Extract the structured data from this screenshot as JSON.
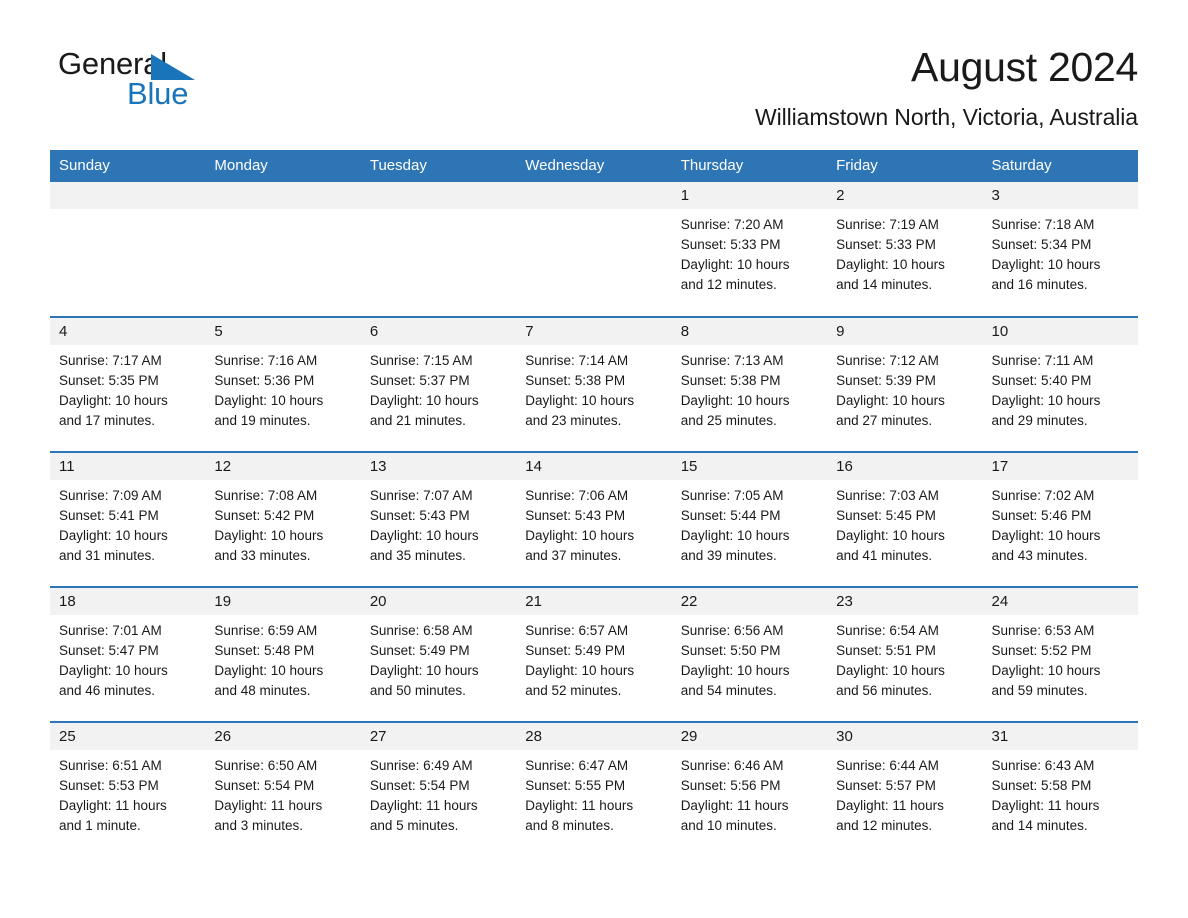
{
  "brand": {
    "name_part1": "General",
    "name_part2": "Blue",
    "triangle_icon": "triangle-icon",
    "accent_color": "#1a74ba"
  },
  "header": {
    "title": "August 2024",
    "subtitle": "Williamstown North, Victoria, Australia"
  },
  "theme": {
    "header_row_bg": "#2e75b6",
    "daynum_bg": "#f2f2f2",
    "text_color": "#1a1a1a",
    "page_bg": "#ffffff"
  },
  "calendar": {
    "weekday_headers": [
      "Sunday",
      "Monday",
      "Tuesday",
      "Wednesday",
      "Thursday",
      "Friday",
      "Saturday"
    ],
    "weeks": [
      [
        {
          "day": "",
          "lines": []
        },
        {
          "day": "",
          "lines": []
        },
        {
          "day": "",
          "lines": []
        },
        {
          "day": "",
          "lines": []
        },
        {
          "day": "1",
          "lines": [
            "Sunrise: 7:20 AM",
            "Sunset: 5:33 PM",
            "Daylight: 10 hours",
            "and 12 minutes."
          ]
        },
        {
          "day": "2",
          "lines": [
            "Sunrise: 7:19 AM",
            "Sunset: 5:33 PM",
            "Daylight: 10 hours",
            "and 14 minutes."
          ]
        },
        {
          "day": "3",
          "lines": [
            "Sunrise: 7:18 AM",
            "Sunset: 5:34 PM",
            "Daylight: 10 hours",
            "and 16 minutes."
          ]
        }
      ],
      [
        {
          "day": "4",
          "lines": [
            "Sunrise: 7:17 AM",
            "Sunset: 5:35 PM",
            "Daylight: 10 hours",
            "and 17 minutes."
          ]
        },
        {
          "day": "5",
          "lines": [
            "Sunrise: 7:16 AM",
            "Sunset: 5:36 PM",
            "Daylight: 10 hours",
            "and 19 minutes."
          ]
        },
        {
          "day": "6",
          "lines": [
            "Sunrise: 7:15 AM",
            "Sunset: 5:37 PM",
            "Daylight: 10 hours",
            "and 21 minutes."
          ]
        },
        {
          "day": "7",
          "lines": [
            "Sunrise: 7:14 AM",
            "Sunset: 5:38 PM",
            "Daylight: 10 hours",
            "and 23 minutes."
          ]
        },
        {
          "day": "8",
          "lines": [
            "Sunrise: 7:13 AM",
            "Sunset: 5:38 PM",
            "Daylight: 10 hours",
            "and 25 minutes."
          ]
        },
        {
          "day": "9",
          "lines": [
            "Sunrise: 7:12 AM",
            "Sunset: 5:39 PM",
            "Daylight: 10 hours",
            "and 27 minutes."
          ]
        },
        {
          "day": "10",
          "lines": [
            "Sunrise: 7:11 AM",
            "Sunset: 5:40 PM",
            "Daylight: 10 hours",
            "and 29 minutes."
          ]
        }
      ],
      [
        {
          "day": "11",
          "lines": [
            "Sunrise: 7:09 AM",
            "Sunset: 5:41 PM",
            "Daylight: 10 hours",
            "and 31 minutes."
          ]
        },
        {
          "day": "12",
          "lines": [
            "Sunrise: 7:08 AM",
            "Sunset: 5:42 PM",
            "Daylight: 10 hours",
            "and 33 minutes."
          ]
        },
        {
          "day": "13",
          "lines": [
            "Sunrise: 7:07 AM",
            "Sunset: 5:43 PM",
            "Daylight: 10 hours",
            "and 35 minutes."
          ]
        },
        {
          "day": "14",
          "lines": [
            "Sunrise: 7:06 AM",
            "Sunset: 5:43 PM",
            "Daylight: 10 hours",
            "and 37 minutes."
          ]
        },
        {
          "day": "15",
          "lines": [
            "Sunrise: 7:05 AM",
            "Sunset: 5:44 PM",
            "Daylight: 10 hours",
            "and 39 minutes."
          ]
        },
        {
          "day": "16",
          "lines": [
            "Sunrise: 7:03 AM",
            "Sunset: 5:45 PM",
            "Daylight: 10 hours",
            "and 41 minutes."
          ]
        },
        {
          "day": "17",
          "lines": [
            "Sunrise: 7:02 AM",
            "Sunset: 5:46 PM",
            "Daylight: 10 hours",
            "and 43 minutes."
          ]
        }
      ],
      [
        {
          "day": "18",
          "lines": [
            "Sunrise: 7:01 AM",
            "Sunset: 5:47 PM",
            "Daylight: 10 hours",
            "and 46 minutes."
          ]
        },
        {
          "day": "19",
          "lines": [
            "Sunrise: 6:59 AM",
            "Sunset: 5:48 PM",
            "Daylight: 10 hours",
            "and 48 minutes."
          ]
        },
        {
          "day": "20",
          "lines": [
            "Sunrise: 6:58 AM",
            "Sunset: 5:49 PM",
            "Daylight: 10 hours",
            "and 50 minutes."
          ]
        },
        {
          "day": "21",
          "lines": [
            "Sunrise: 6:57 AM",
            "Sunset: 5:49 PM",
            "Daylight: 10 hours",
            "and 52 minutes."
          ]
        },
        {
          "day": "22",
          "lines": [
            "Sunrise: 6:56 AM",
            "Sunset: 5:50 PM",
            "Daylight: 10 hours",
            "and 54 minutes."
          ]
        },
        {
          "day": "23",
          "lines": [
            "Sunrise: 6:54 AM",
            "Sunset: 5:51 PM",
            "Daylight: 10 hours",
            "and 56 minutes."
          ]
        },
        {
          "day": "24",
          "lines": [
            "Sunrise: 6:53 AM",
            "Sunset: 5:52 PM",
            "Daylight: 10 hours",
            "and 59 minutes."
          ]
        }
      ],
      [
        {
          "day": "25",
          "lines": [
            "Sunrise: 6:51 AM",
            "Sunset: 5:53 PM",
            "Daylight: 11 hours",
            "and 1 minute."
          ]
        },
        {
          "day": "26",
          "lines": [
            "Sunrise: 6:50 AM",
            "Sunset: 5:54 PM",
            "Daylight: 11 hours",
            "and 3 minutes."
          ]
        },
        {
          "day": "27",
          "lines": [
            "Sunrise: 6:49 AM",
            "Sunset: 5:54 PM",
            "Daylight: 11 hours",
            "and 5 minutes."
          ]
        },
        {
          "day": "28",
          "lines": [
            "Sunrise: 6:47 AM",
            "Sunset: 5:55 PM",
            "Daylight: 11 hours",
            "and 8 minutes."
          ]
        },
        {
          "day": "29",
          "lines": [
            "Sunrise: 6:46 AM",
            "Sunset: 5:56 PM",
            "Daylight: 11 hours",
            "and 10 minutes."
          ]
        },
        {
          "day": "30",
          "lines": [
            "Sunrise: 6:44 AM",
            "Sunset: 5:57 PM",
            "Daylight: 11 hours",
            "and 12 minutes."
          ]
        },
        {
          "day": "31",
          "lines": [
            "Sunrise: 6:43 AM",
            "Sunset: 5:58 PM",
            "Daylight: 11 hours",
            "and 14 minutes."
          ]
        }
      ]
    ]
  }
}
